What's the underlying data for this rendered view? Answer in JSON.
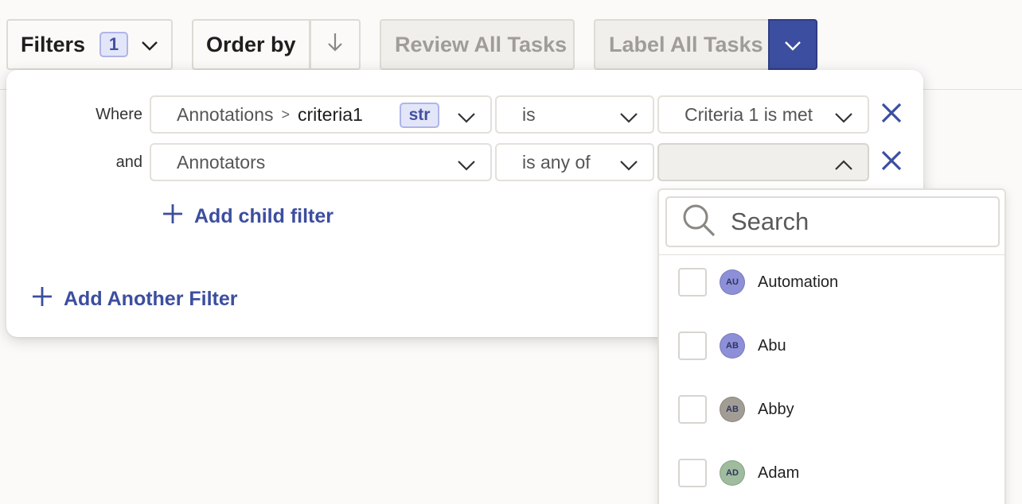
{
  "toolbar": {
    "filters_label": "Filters",
    "filters_count": "1",
    "order_label": "Order by",
    "review_label": "Review All Tasks",
    "label_label": "Label All Tasks"
  },
  "filter_panel": {
    "rows": [
      {
        "connector": "Where",
        "field_parent": "Annotations",
        "field_separator": ">",
        "field_name": "criteria1",
        "field_type": "str",
        "operator": "is",
        "value": "Criteria 1 is met"
      },
      {
        "connector": "and",
        "field_name": "Annotators",
        "operator": "is any of",
        "value": ""
      }
    ],
    "add_child_label": "Add child filter",
    "add_another_label": "Add Another Filter"
  },
  "annotator_dropdown": {
    "search_placeholder": "Search",
    "options": [
      {
        "initials": "AU",
        "name": "Automation",
        "avatar_color": "#8d90d8"
      },
      {
        "initials": "AB",
        "name": "Abu",
        "avatar_color": "#8d90d8"
      },
      {
        "initials": "AB",
        "name": "Abby",
        "avatar_color": "#a29d94"
      },
      {
        "initials": "AD",
        "name": "Adam",
        "avatar_color": "#9fbc9e"
      }
    ]
  },
  "colors": {
    "accent": "#3c4e9f",
    "badge_bg": "#e3e6f8",
    "badge_border": "#aeb5e8"
  }
}
